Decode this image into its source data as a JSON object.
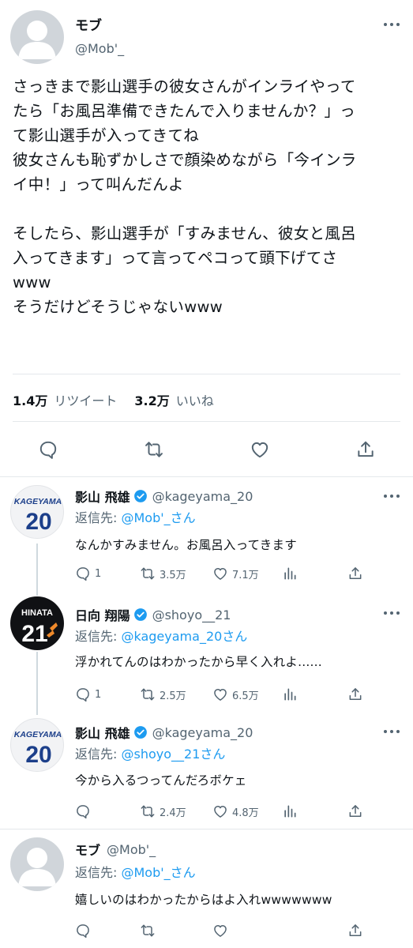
{
  "main_tweet": {
    "name": "モブ",
    "handle": "@Mob'_",
    "text": "さっきまで影山選手の彼女さんがインライやって\nたら「お風呂準備できたんで入りませんか？」っ\nて影山選手が入ってきてね\n彼女さんも恥ずかしさで顔染めながら「今インラ\nイ中！」って叫んだんよ\n\nそしたら、影山選手が「すみません、彼女と風呂\n入ってきます」って言ってペコって頭下げてさ\nwww\nそうだけどそうじゃないwww",
    "retweets_value": "1.4万",
    "retweets_label": "リツイート",
    "likes_value": "3.2万",
    "likes_label": "いいね"
  },
  "replies": [
    {
      "name": "影山 飛雄",
      "handle": "@kageyama_20",
      "replyto_prefix": "返信先: ",
      "replyto_link": "@Mob'_さん",
      "text": "なんかすみません。お風呂入ってきます",
      "replies": "1",
      "retweets": "3.5万",
      "likes": "7.1万",
      "avatar_label": "KAGEYAMA",
      "avatar_number": "20"
    },
    {
      "name": "日向 翔陽",
      "handle": "@shoyo__21",
      "replyto_prefix": "返信先: ",
      "replyto_link": "@kageyama_20さん",
      "text": "浮かれてんのはわかったから早く入れよ......",
      "replies": "1",
      "retweets": "2.5万",
      "likes": "6.5万",
      "avatar_label": "HINATA",
      "avatar_number": "21"
    },
    {
      "name": "影山 飛雄",
      "handle": "@kageyama_20",
      "replyto_prefix": "返信先: ",
      "replyto_link": "@shoyo__21さん",
      "text": "今から入るつってんだろボケェ",
      "replies": "",
      "retweets": "2.4万",
      "likes": "4.8万",
      "avatar_label": "KAGEYAMA",
      "avatar_number": "20"
    },
    {
      "name": "モブ",
      "handle": "@Mob'_",
      "replyto_prefix": "返信先: ",
      "replyto_link": "@Mob'_さん",
      "text": "嬉しいのはわかったからはよ入れwwwwwww"
    }
  ],
  "icons": {
    "reply": "reply-bubble-icon",
    "retweet": "retweet-icon",
    "like": "heart-icon",
    "share": "share-upload-icon",
    "analytics": "analytics-bars-icon",
    "verified": "verified-badge-icon",
    "more": "more-dots-icon"
  },
  "colors": {
    "link": "#1d9bf0",
    "secondary_text": "#536471",
    "primary_text": "#0f1419",
    "kageyama_blue": "#1c3f8a",
    "hinata_orange": "#f08a2b"
  }
}
